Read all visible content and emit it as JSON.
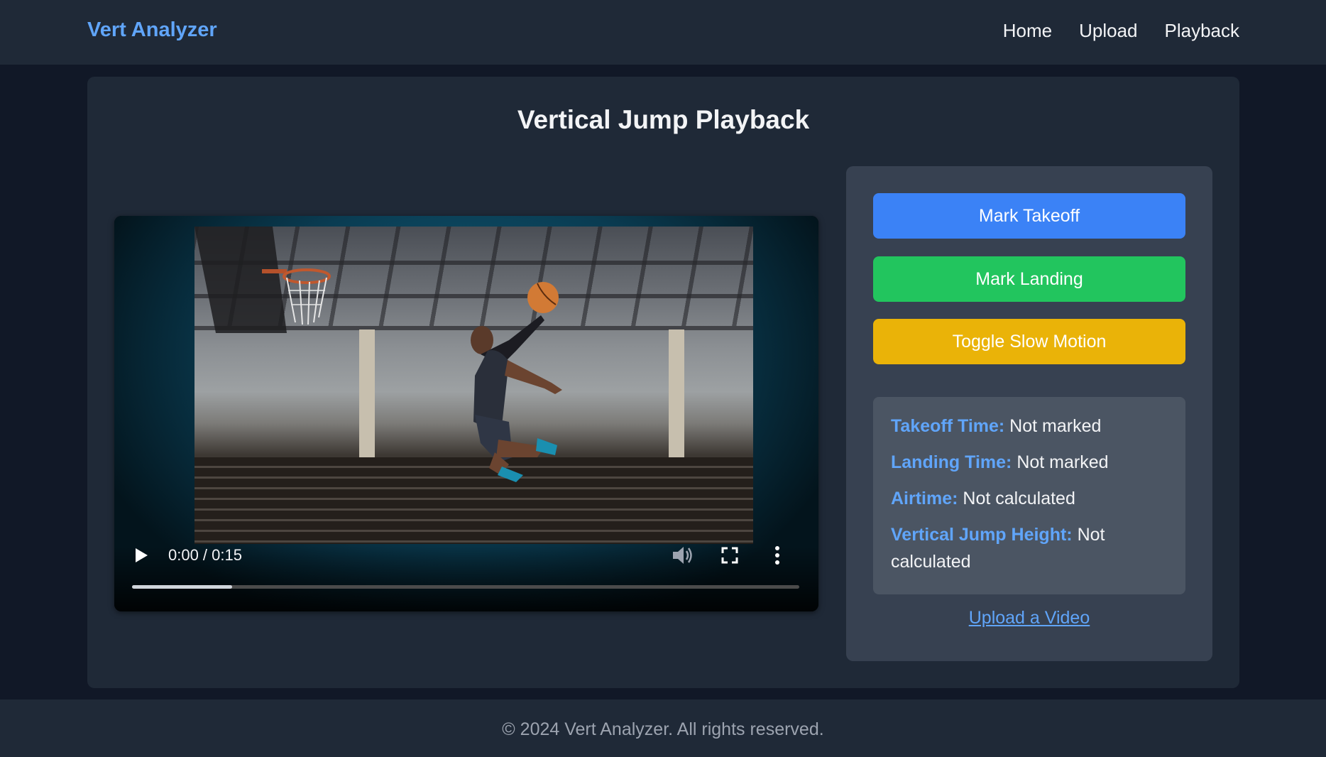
{
  "header": {
    "brand": "Vert Analyzer",
    "nav": [
      "Home",
      "Upload",
      "Playback"
    ]
  },
  "main": {
    "title": "Vertical Jump Playback"
  },
  "video": {
    "current_time": "0:00",
    "duration": "0:15",
    "time_display": "0:00 / 0:15",
    "progress_fraction": 0.15
  },
  "controls": {
    "mark_takeoff": "Mark Takeoff",
    "mark_landing": "Mark Landing",
    "toggle_slow_motion": "Toggle Slow Motion"
  },
  "stats": {
    "takeoff_label": "Takeoff Time:",
    "takeoff_value": "Not marked",
    "landing_label": "Landing Time:",
    "landing_value": "Not marked",
    "airtime_label": "Airtime:",
    "airtime_value": "Not calculated",
    "height_label": "Vertical Jump Height:",
    "height_value": "Not calculated"
  },
  "links": {
    "upload": "Upload a Video"
  },
  "footer": {
    "text": "© 2024 Vert Analyzer. All rights reserved."
  },
  "colors": {
    "accent": "#60a5fa",
    "takeoff_button": "#3b82f6",
    "landing_button": "#22c55e",
    "slowmo_button": "#eab308"
  }
}
